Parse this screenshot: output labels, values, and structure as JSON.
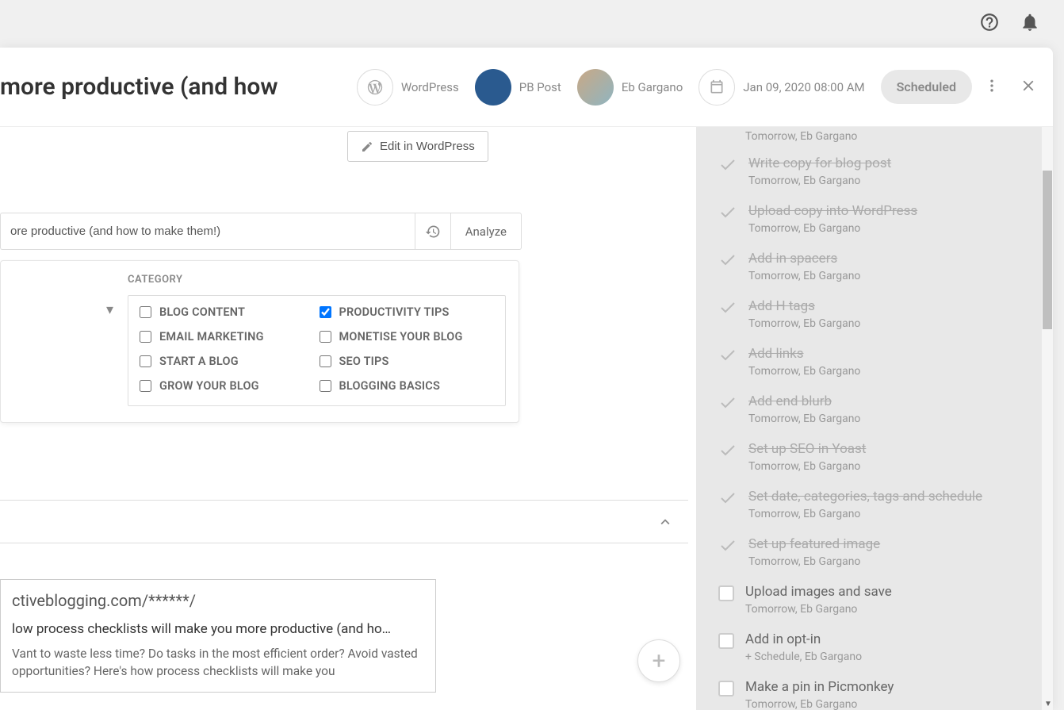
{
  "topbar": {},
  "header": {
    "title_fragment": "more productive (and how",
    "platform": "WordPress",
    "post_type": "PB Post",
    "author": "Eb Gargano",
    "schedule": "Jan 09, 2020 08:00 AM",
    "status": "Scheduled"
  },
  "edit_button": "Edit in WordPress",
  "title_input": "ore productive (and how to make them!)",
  "analyze": "Analyze",
  "category": {
    "label": "CATEGORY",
    "items": [
      {
        "label": "BLOG CONTENT",
        "checked": false
      },
      {
        "label": "EMAIL MARKETING",
        "checked": false
      },
      {
        "label": "START A BLOG",
        "checked": false
      },
      {
        "label": "GROW YOUR BLOG",
        "checked": false
      },
      {
        "label": "PRODUCTIVITY TIPS",
        "checked": true
      },
      {
        "label": "MONETISE YOUR BLOG",
        "checked": false
      },
      {
        "label": "SEO TIPS",
        "checked": false
      },
      {
        "label": "BLOGGING BASICS",
        "checked": false
      }
    ]
  },
  "seo": {
    "url": "ctiveblogging.com/******/",
    "title": "low process checklists will make you more productive (and ho…",
    "desc": "Vant to waste less time? Do tasks in the most efficient order? Avoid vasted opportunities? Here's how process checklists will make you"
  },
  "tasks_top_meta": "Tomorrow,  Eb Gargano",
  "tasks": [
    {
      "title": "Write copy for blog post",
      "done": true,
      "meta": "Tomorrow,  Eb Gargano"
    },
    {
      "title": "Upload copy into WordPress",
      "done": true,
      "meta": "Tomorrow,  Eb Gargano"
    },
    {
      "title": "Add in spacers",
      "done": true,
      "meta": "Tomorrow,  Eb Gargano"
    },
    {
      "title": "Add H tags",
      "done": true,
      "meta": "Tomorrow,  Eb Gargano"
    },
    {
      "title": "Add links",
      "done": true,
      "meta": "Tomorrow,  Eb Gargano"
    },
    {
      "title": "Add end blurb",
      "done": true,
      "meta": "Tomorrow,  Eb Gargano"
    },
    {
      "title": "Set up SEO in Yoast",
      "done": true,
      "meta": "Tomorrow,  Eb Gargano"
    },
    {
      "title": "Set date, categories, tags and schedule",
      "done": true,
      "meta": "Tomorrow,  Eb Gargano"
    },
    {
      "title": "Set up featured image",
      "done": true,
      "meta": "Tomorrow,  Eb Gargano"
    },
    {
      "title": "Upload images and save",
      "done": false,
      "meta": "Tomorrow,  Eb Gargano"
    },
    {
      "title": "Add in opt-in",
      "done": false,
      "meta": "+ Schedule,  Eb Gargano"
    },
    {
      "title": "Make a pin in Picmonkey",
      "done": false,
      "meta": "Tomorrow,  Eb Gargano"
    }
  ]
}
